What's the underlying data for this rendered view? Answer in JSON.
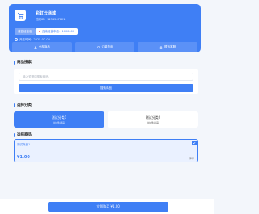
{
  "store": {
    "name": "彩虹云商城",
    "id_label": "档案ID：1234567891",
    "tag_primary": "诚信经营店",
    "tag_secondary": "连续经营本店：1000000",
    "open_time": "开店时间：2025-02-03",
    "actions": [
      {
        "label": "全部商品",
        "icon": "user-icon"
      },
      {
        "label": "订单查询",
        "icon": "search-icon"
      },
      {
        "label": "联系客服",
        "icon": "lock-icon"
      }
    ]
  },
  "search": {
    "title": "商品搜索",
    "placeholder": "输入关键词搜索商品",
    "button_label": "搜索商品"
  },
  "categories": {
    "title": "选择分类",
    "items": [
      {
        "name": "测试分类1",
        "count": "共1件商品",
        "active": true
      },
      {
        "name": "测试分类2",
        "count": "共0件商品",
        "active": false
      }
    ]
  },
  "products": {
    "title": "选择商品",
    "items": [
      {
        "name": "测试商品1",
        "price": "¥1.00",
        "stock": "库存",
        "selected": true
      }
    ]
  },
  "bottom": {
    "buy_label": "立即购买 ¥1.00"
  },
  "colors": {
    "primary": "#3f7ff5",
    "background": "#f3f6fb"
  }
}
